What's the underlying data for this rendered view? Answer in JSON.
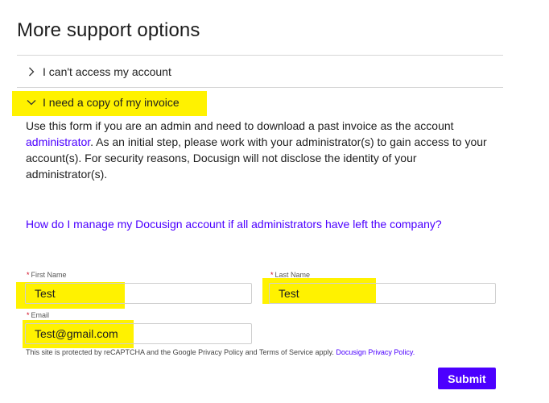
{
  "page": {
    "title": "More support options"
  },
  "accordion": {
    "item1": {
      "label": "I can't access my account"
    },
    "item2": {
      "label": "I need a copy of my invoice"
    }
  },
  "description": {
    "part1": "Use this form if you are an admin and need to download a past invoice as the account ",
    "link": "administrator",
    "part2": ". As an initial step, please work with your administrator(s) to gain access to your account(s). For security reasons, Docusign will not disclose the identity of your administrator(s)."
  },
  "faq_link": "How do I manage my Docusign account if all administrators have left the company?",
  "form": {
    "first_name": {
      "label": "First Name",
      "value": "Test"
    },
    "last_name": {
      "label": "Last Name",
      "value": "Test"
    },
    "email": {
      "label": "Email",
      "value": "Test@gmail.com"
    },
    "required_marker": "*"
  },
  "recaptcha": {
    "text": "This site is protected by reCAPTCHA and the Google Privacy Policy and Terms of Service apply. ",
    "link": "Docusign Privacy Policy."
  },
  "submit_label": "Submit",
  "colors": {
    "accent": "#4c00ff",
    "highlight": "#fff200",
    "required": "#d0021b"
  }
}
